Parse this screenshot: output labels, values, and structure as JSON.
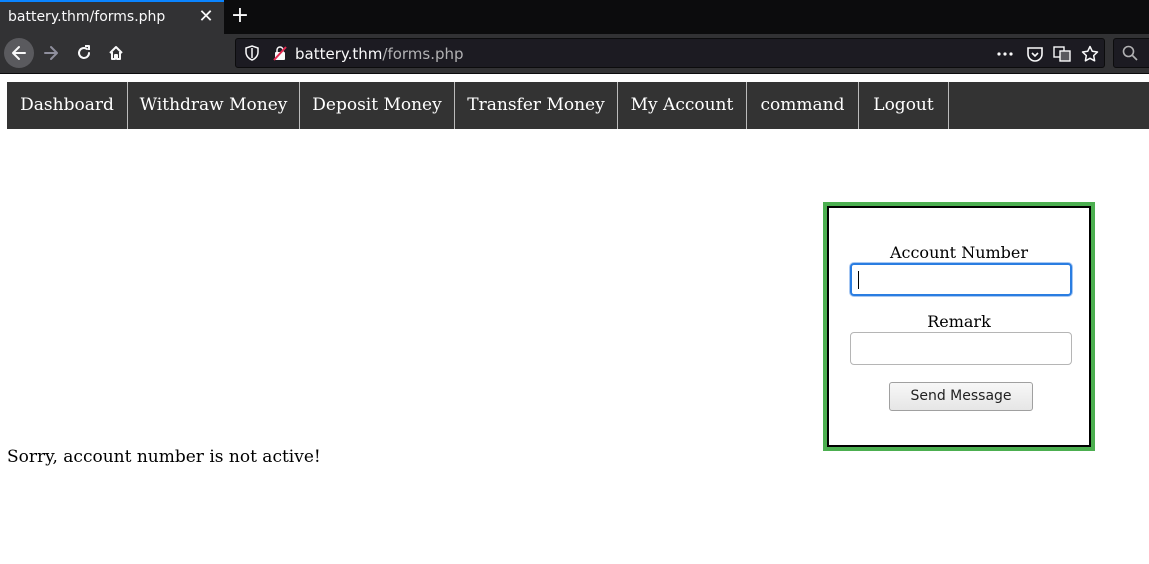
{
  "browser": {
    "tab_title": "battery.thm/forms.php",
    "url_host": "battery.thm",
    "url_path": "/forms.php"
  },
  "nav": {
    "items": [
      "Dashboard",
      "Withdraw Money",
      "Deposit Money",
      "Transfer Money",
      "My Account",
      "command",
      "Logout"
    ]
  },
  "form": {
    "account_label": "Account Number",
    "account_value": "",
    "remark_label": "Remark",
    "remark_value": "",
    "submit_label": "Send Message"
  },
  "status": {
    "message": "Sorry, account number is not active!"
  },
  "colors": {
    "navbar_bg": "#333333",
    "form_border": "#4caf50",
    "browser_chrome": "#323234",
    "focus_ring": "#2a7de1"
  }
}
